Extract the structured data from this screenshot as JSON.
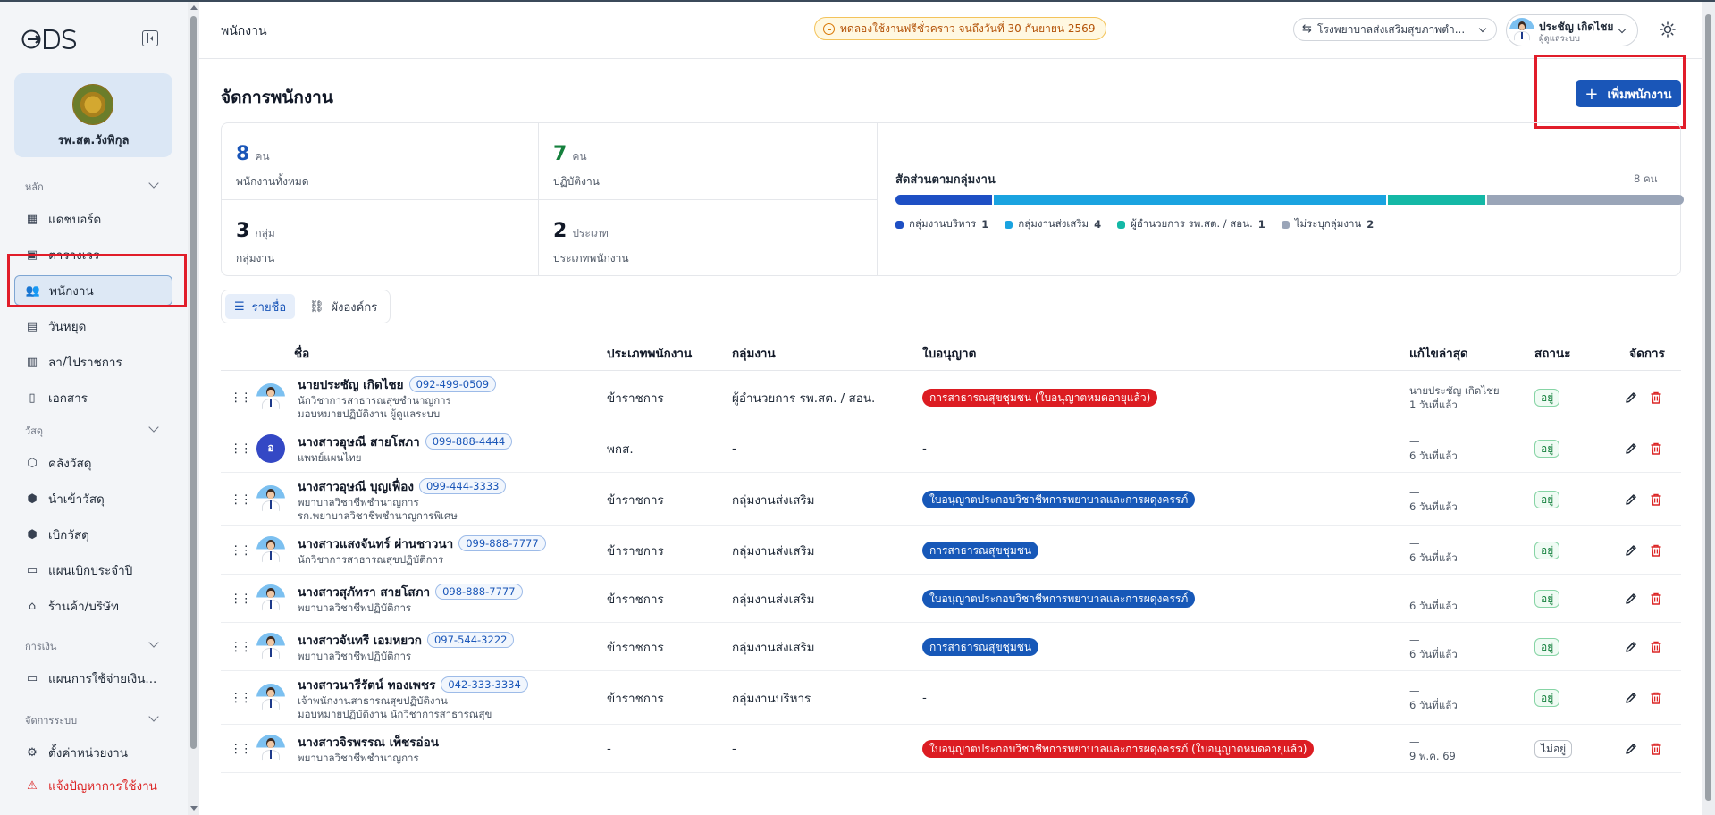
{
  "brand": {
    "logo_text": "ODS"
  },
  "org": {
    "name": "รพ.สต.วังพิกุล"
  },
  "sidebar": {
    "sections": [
      {
        "label": "หลัก",
        "items": [
          {
            "label": "แดชบอร์ด",
            "icon": "dashboard-icon"
          },
          {
            "label": "ตารางเวร",
            "icon": "calendar-icon"
          },
          {
            "label": "พนักงาน",
            "icon": "users-icon",
            "active": true
          },
          {
            "label": "วันหยุด",
            "icon": "calendar-off-icon"
          },
          {
            "label": "ลา/ไปราชการ",
            "icon": "calendar-leave-icon"
          },
          {
            "label": "เอกสาร",
            "icon": "document-icon"
          }
        ]
      },
      {
        "label": "วัสดุ",
        "items": [
          {
            "label": "คลังวัสดุ",
            "icon": "package-icon"
          },
          {
            "label": "นำเข้าวัสดุ",
            "icon": "package-in-icon"
          },
          {
            "label": "เบิกวัสดุ",
            "icon": "package-out-icon"
          },
          {
            "label": "แผนเบิกประจำปี",
            "icon": "clipboard-icon"
          },
          {
            "label": "ร้านค้า/บริษัท",
            "icon": "store-icon"
          }
        ]
      },
      {
        "label": "การเงิน",
        "items": [
          {
            "label": "แผนการใช้จ่ายเงิน...",
            "icon": "wallet-icon"
          }
        ]
      },
      {
        "label": "จัดการระบบ",
        "items": [
          {
            "label": "ตั้งค่าหน่วยงาน",
            "icon": "gear-icon"
          },
          {
            "label": "แจ้งปัญหาการใช้งาน",
            "icon": "alert-icon",
            "danger": true
          }
        ]
      }
    ]
  },
  "topbar": {
    "title": "พนักงาน",
    "trial_text": "ทดลองใช้งานฟรีชั่วคราว จนถึงวันที่ 30 กันยายน 2569",
    "facility": "โรงพยาบาลส่งเสริมสุขภาพตำ...",
    "user_name": "ประชัญ เกิดไชย",
    "user_role": "ผู้ดูแลระบบ"
  },
  "page": {
    "title": "จัดการพนักงาน",
    "add_button": "เพิ่มพนักงาน"
  },
  "stats": {
    "total": {
      "value": "8",
      "unit": "คน",
      "label": "พนักงานทั้งหมด"
    },
    "active": {
      "value": "7",
      "unit": "คน",
      "label": "ปฏิบัติงาน"
    },
    "groups": {
      "value": "3",
      "unit": "กลุ่ม",
      "label": "กลุ่มงาน"
    },
    "types": {
      "value": "2",
      "unit": "ประเภท",
      "label": "ประเภทพนักงาน"
    }
  },
  "distribution": {
    "title": "สัดส่วนตามกลุ่มงาน",
    "total_label": "8 คน",
    "segments": [
      {
        "name": "กลุ่มงานบริหาร",
        "count": 1,
        "color": "#1e4fc4"
      },
      {
        "name": "กลุ่มงานส่งเสริม",
        "count": 4,
        "color": "#1aa3e0"
      },
      {
        "name": "ผู้อำนวยการ รพ.สต. / สอน.",
        "count": 1,
        "color": "#14b8a6"
      },
      {
        "name": "ไม่ระบุกลุ่มงาน",
        "count": 2,
        "color": "#9aa5b8"
      }
    ]
  },
  "view_tabs": {
    "list": "รายชื่อ",
    "org": "ผังองค์กร"
  },
  "table": {
    "headers": {
      "name": "ชื่อ",
      "type": "ประเภทพนักงาน",
      "group": "กลุ่มงาน",
      "license": "ใบอนุญาต",
      "updated": "แก้ไขล่าสุด",
      "status": "สถานะ",
      "actions": "จัดการ"
    },
    "rows": [
      {
        "name": "นายประชัญ เกิดไชย",
        "phone": "092-499-0509",
        "sub1": "นักวิชาการสาธารณสุขชำนาญการ",
        "sub2": "มอบหมายปฏิบัติงาน ผู้ดูแลระบบ",
        "type": "ข้าราชการ",
        "group": "ผู้อำนวยการ รพ.สต. / สอน.",
        "license": "การสาธารณสุขชุมชน (ใบอนุญาตหมดอายุแล้ว)",
        "license_color": "red",
        "upd1": "นายประชัญ เกิดไชย",
        "upd2": "1 วันที่แล้ว",
        "status": "อยู่",
        "status_on": true,
        "avatar": "photo"
      },
      {
        "name": "นางสาวอุษณี สายโสภา",
        "phone": "099-888-4444",
        "sub1": "แพทย์แผนไทย",
        "sub2": "",
        "type": "พกส.",
        "group": "-",
        "license": "-",
        "license_color": "",
        "upd1": "—",
        "upd2": "6 วันที่แล้ว",
        "status": "อยู่",
        "status_on": true,
        "avatar": "initial",
        "initial": "อ"
      },
      {
        "name": "นางสาวอุษณี บุญเฟื่อง",
        "phone": "099-444-3333",
        "sub1": "พยาบาลวิชาชีพชำนาญการ",
        "sub2": "รก.พยาบาลวิชาชีพชำนาญการพิเศษ",
        "type": "ข้าราชการ",
        "group": "กลุ่มงานส่งเสริม",
        "license": "ใบอนุญาตประกอบวิชาชีพการพยาบาลและการผดุงครรภ์",
        "license_color": "blue",
        "upd1": "—",
        "upd2": "6 วันที่แล้ว",
        "status": "อยู่",
        "status_on": true,
        "avatar": "photo"
      },
      {
        "name": "นางสาวแสงจันทร์ ผ่านชาวนา",
        "phone": "099-888-7777",
        "sub1": "นักวิชาการสาธารณสุขปฏิบัติการ",
        "sub2": "",
        "type": "ข้าราชการ",
        "group": "กลุ่มงานส่งเสริม",
        "license": "การสาธารณสุขชุมชน",
        "license_color": "blue",
        "upd1": "—",
        "upd2": "6 วันที่แล้ว",
        "status": "อยู่",
        "status_on": true,
        "avatar": "photo"
      },
      {
        "name": "นางสาวสุภัทรา สายโสภา",
        "phone": "098-888-7777",
        "sub1": "พยาบาลวิชาชีพปฏิบัติการ",
        "sub2": "",
        "type": "ข้าราชการ",
        "group": "กลุ่มงานส่งเสริม",
        "license": "ใบอนุญาตประกอบวิชาชีพการพยาบาลและการผดุงครรภ์",
        "license_color": "blue",
        "upd1": "—",
        "upd2": "6 วันที่แล้ว",
        "status": "อยู่",
        "status_on": true,
        "avatar": "photo"
      },
      {
        "name": "นางสาวจันทรี เอมหยวก",
        "phone": "097-544-3222",
        "sub1": "พยาบาลวิชาชีพปฏิบัติการ",
        "sub2": "",
        "type": "ข้าราชการ",
        "group": "กลุ่มงานส่งเสริม",
        "license": "การสาธารณสุขชุมชน",
        "license_color": "blue",
        "upd1": "—",
        "upd2": "6 วันที่แล้ว",
        "status": "อยู่",
        "status_on": true,
        "avatar": "photo"
      },
      {
        "name": "นางสาวนารีรัตน์ ทองเพชร",
        "phone": "042-333-3334",
        "sub1": "เจ้าพนักงานสาธารณสุขปฏิบัติงาน",
        "sub2": "มอบหมายปฏิบัติงาน นักวิชาการสาธารณสุข",
        "type": "ข้าราชการ",
        "group": "กลุ่มงานบริหาร",
        "license": "-",
        "license_color": "",
        "upd1": "—",
        "upd2": "6 วันที่แล้ว",
        "status": "อยู่",
        "status_on": true,
        "avatar": "photo"
      },
      {
        "name": "นางสาวจิรพรรณ เพ็ชรอ่อน",
        "phone": "",
        "sub1": "พยาบาลวิชาชีพชำนาญการ",
        "sub2": "",
        "type": "-",
        "group": "-",
        "license": "ใบอนุญาตประกอบวิชาชีพการพยาบาลและการผดุงครรภ์ (ใบอนุญาตหมดอายุแล้ว)",
        "license_color": "red",
        "upd1": "—",
        "upd2": "9 พ.ค. 69",
        "status": "ไม่อยู่",
        "status_on": false,
        "avatar": "photo"
      }
    ]
  }
}
